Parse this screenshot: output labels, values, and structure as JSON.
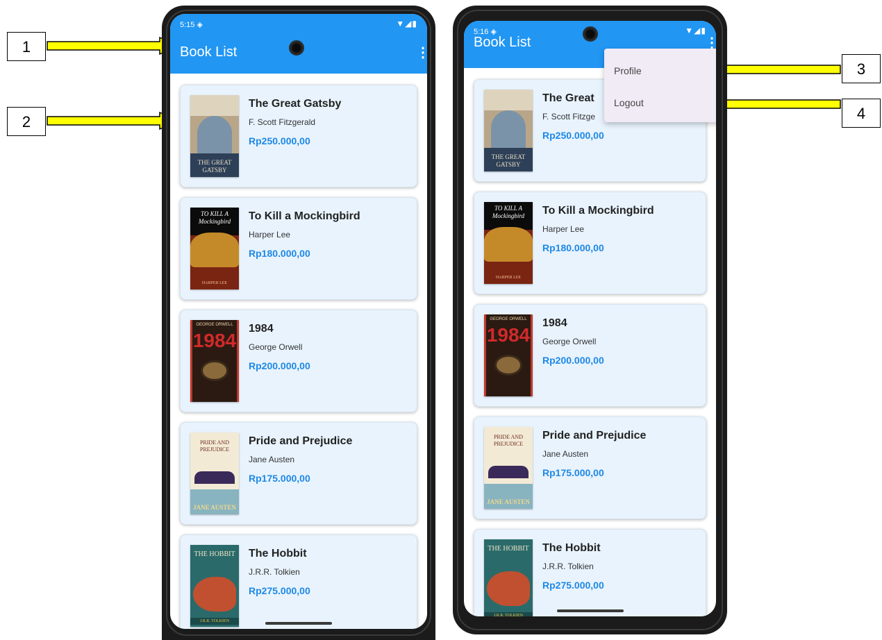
{
  "app": {
    "title": "Book List",
    "menu_icon": "more-vert-icon"
  },
  "screens": [
    {
      "status_time": "5:15 ◈",
      "status_icons": "▼◢▮",
      "books": [
        {
          "title": "The Great Gatsby",
          "author": "F. Scott Fitzgerald",
          "price": "Rp250.000,00"
        },
        {
          "title": "To Kill a Mockingbird",
          "author": "Harper Lee",
          "price": "Rp180.000,00"
        },
        {
          "title": "1984",
          "author": "George Orwell",
          "price": "Rp200.000,00"
        },
        {
          "title": "Pride and Prejudice",
          "author": "Jane Austen",
          "price": "Rp175.000,00"
        },
        {
          "title": "The Hobbit",
          "author": "J.R.R. Tolkien",
          "price": "Rp275.000,00"
        }
      ]
    },
    {
      "status_time": "5:16 ◈",
      "status_icons": "▼◢▮",
      "books": [
        {
          "title": "The Great",
          "author": "F. Scott Fitzge",
          "price": "Rp250.000,00"
        },
        {
          "title": "To Kill a Mockingbird",
          "author": "Harper Lee",
          "price": "Rp180.000,00"
        },
        {
          "title": "1984",
          "author": "George Orwell",
          "price": "Rp200.000,00"
        },
        {
          "title": "Pride and Prejudice",
          "author": "Jane Austen",
          "price": "Rp175.000,00"
        },
        {
          "title": "The Hobbit",
          "author": "J.R.R. Tolkien",
          "price": "Rp275.000,00"
        }
      ]
    }
  ],
  "dropdown": {
    "items": [
      "Profile",
      "Logout"
    ]
  },
  "covers": {
    "gatsby": {
      "text": "THE GREAT GATSBY"
    },
    "mockingbird": {
      "text": "TO KILL A Mockingbird",
      "author": "HARPER LEE"
    },
    "nineteen84": {
      "author": "GEORGE ORWELL",
      "number": "1984"
    },
    "pride": {
      "text": "PRIDE AND PREJUDICE",
      "author": "JANE AUSTEN"
    },
    "hobbit": {
      "text": "THE HOBBIT",
      "author": "J.R.R. TOLKIEN"
    }
  },
  "callouts": [
    "1",
    "2",
    "3",
    "4"
  ],
  "colors": {
    "app_bar": "#2196f3",
    "card_bg": "#e8f3fd",
    "price": "#1e88e5",
    "arrow_fill": "#ffff00",
    "menu_bg": "#f1ebf6"
  }
}
